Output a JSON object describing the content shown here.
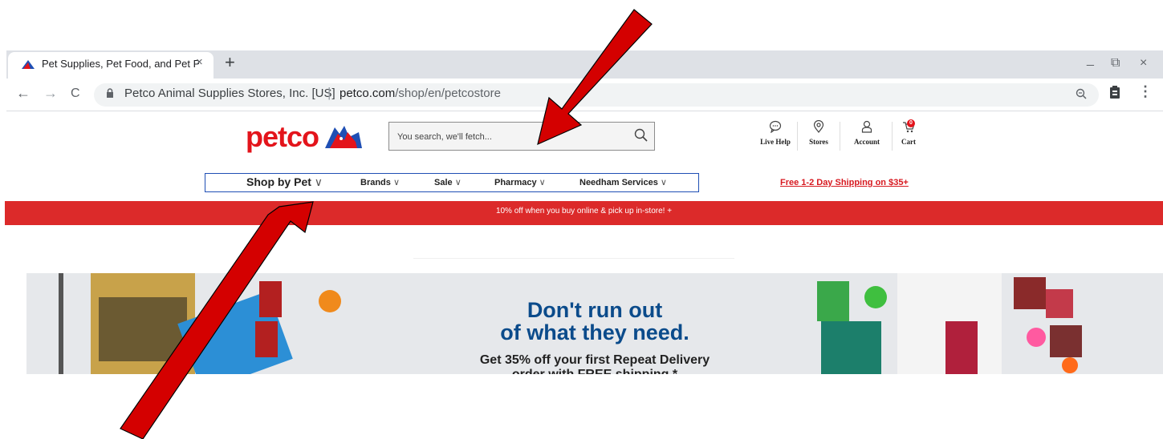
{
  "browser": {
    "tab_title": "Pet Supplies, Pet Food, and Pet Products",
    "tab_close": "×",
    "new_tab": "+",
    "window": {
      "minimize": "_",
      "restore": "⧉",
      "close": "×"
    },
    "nav": {
      "back": "←",
      "forward": "→",
      "reload": "C"
    },
    "site_identity": "Petco Animal Supplies Stores, Inc. [US]",
    "separator": "|",
    "url_host": "petco.com",
    "url_path": "/shop/en/petcostore"
  },
  "header": {
    "logo_text": "petco",
    "search_placeholder": "You search, we'll fetch...",
    "live_help": "Live Help",
    "stores": "Stores",
    "account": "Account",
    "cart": "Cart",
    "cart_count": "0"
  },
  "nav": {
    "items": [
      {
        "label": "Shop by Pet"
      },
      {
        "label": "Brands"
      },
      {
        "label": "Sale"
      },
      {
        "label": "Pharmacy"
      },
      {
        "label": "Needham Services"
      }
    ],
    "chevron": "∨",
    "shipping": "Free 1-2 Day Shipping on $35+"
  },
  "promo": {
    "text": "10% off when you buy online & pick up in-store!  +"
  },
  "hero": {
    "line1": "Don't run out",
    "line2": "of what they need.",
    "sub": "Get 35% off your first Repeat Delivery",
    "sub2": "order with FREE shipping.*"
  },
  "colors": {
    "brand": "#e3141b",
    "promo": "#dc2a2a",
    "hero_text": "#0b4b8b",
    "arrow": "#d40000"
  }
}
